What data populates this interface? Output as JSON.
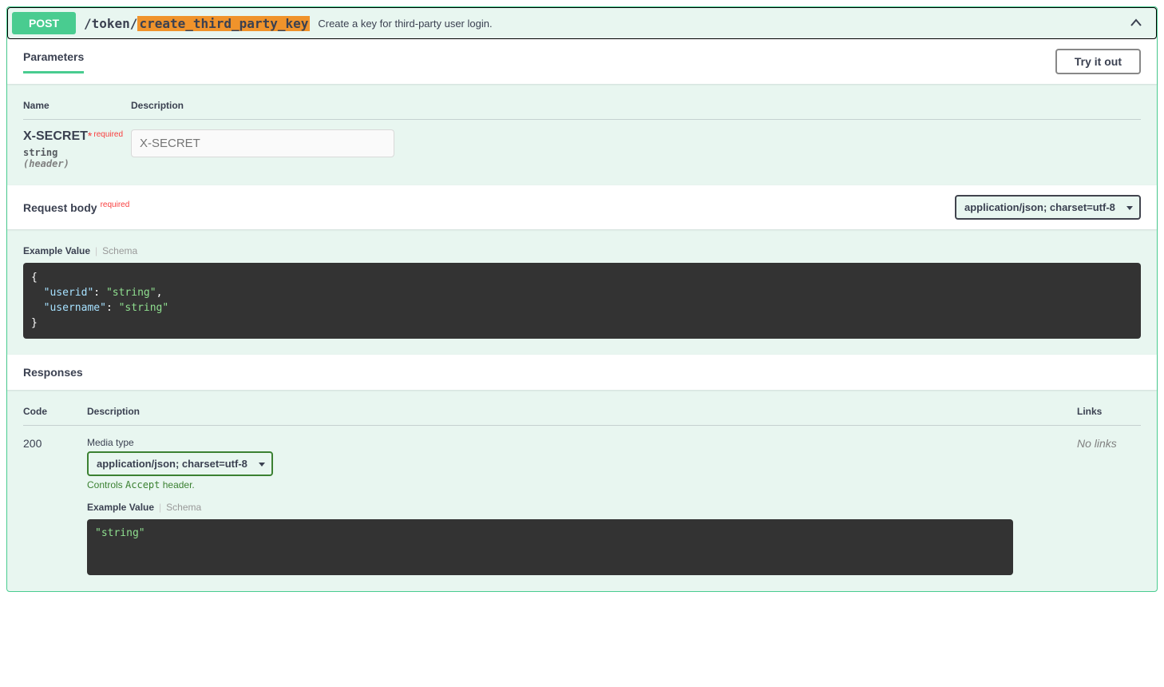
{
  "method": "POST",
  "path_prefix": "/token/",
  "path_highlight": "create_third_party_key",
  "summary": "Create a key for third-party user login.",
  "sections": {
    "parameters": "Parameters",
    "request_body": "Request body",
    "responses": "Responses"
  },
  "try_it_out": "Try it out",
  "param_headers": {
    "name": "Name",
    "description": "Description"
  },
  "params": [
    {
      "name": "X-SECRET",
      "required_star": "*",
      "required_text": "required",
      "type": "string",
      "in": "(header)",
      "placeholder": "X-SECRET"
    }
  ],
  "request_body_required": "required",
  "content_type": "application/json; charset=utf-8",
  "example_tabs": {
    "example": "Example Value",
    "schema": "Schema"
  },
  "example_json": {
    "line1_key": "\"userid\"",
    "line1_val": "\"string\"",
    "line2_key": "\"username\"",
    "line2_val": "\"string\""
  },
  "resp_headers": {
    "code": "Code",
    "description": "Description",
    "links": "Links"
  },
  "responses_list": [
    {
      "code": "200",
      "media_label": "Media type",
      "media_type": "application/json; charset=utf-8",
      "accept_hint_pre": "Controls ",
      "accept_hint_mono": "Accept",
      "accept_hint_post": " header.",
      "example": "\"string\"",
      "links": "No links"
    }
  ]
}
